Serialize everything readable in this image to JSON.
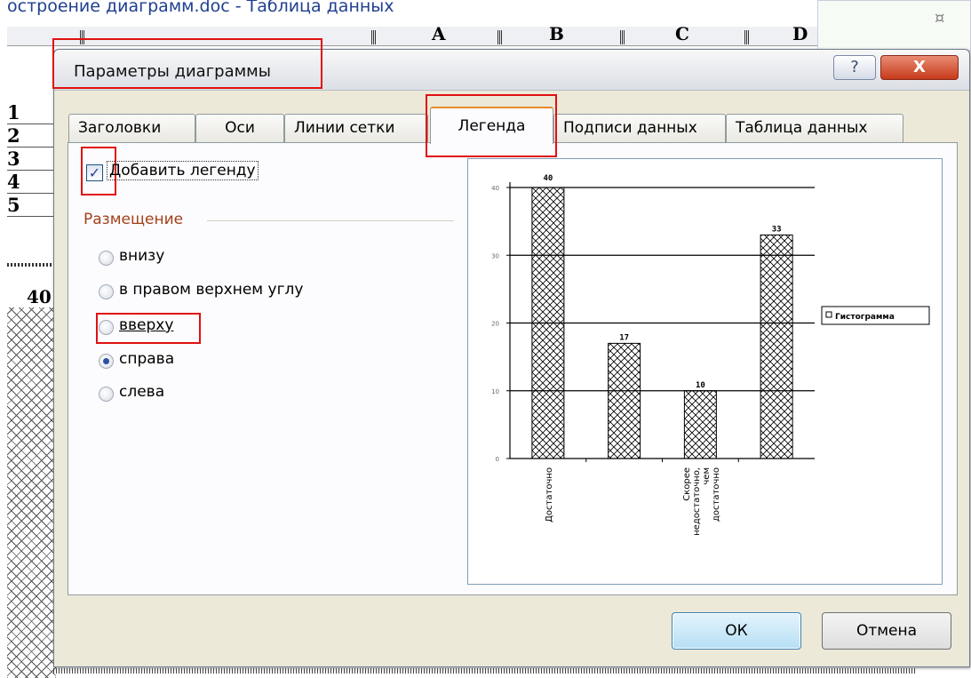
{
  "background": {
    "window_title": "остроение диаграмм.doc - Таблица данных",
    "columns": [
      "A",
      "B",
      "C",
      "D"
    ],
    "rows": [
      "1",
      "2",
      "3",
      "4",
      "5"
    ],
    "cell_value": "40",
    "corner_mark": "¤"
  },
  "dialog": {
    "title": "Параметры диаграммы",
    "help_label": "?",
    "close_label": "X",
    "tabs": [
      {
        "label": "Заголовки"
      },
      {
        "label": "Оси"
      },
      {
        "label": "Линии сетки"
      },
      {
        "label": "Легенда",
        "active": true
      },
      {
        "label": "Подписи данных"
      },
      {
        "label": "Таблица данных"
      }
    ],
    "add_legend_checkbox": {
      "label": "Добавить легенду",
      "checked": true
    },
    "placement_group": {
      "label": "Размещение",
      "options": [
        {
          "label": "внизу",
          "selected": false
        },
        {
          "label": "в правом верхнем углу",
          "selected": false
        },
        {
          "label": "вверху",
          "selected": false
        },
        {
          "label": "справа",
          "selected": true
        },
        {
          "label": "слева",
          "selected": false
        }
      ]
    },
    "buttons": {
      "ok": "ОК",
      "cancel": "Отмена"
    },
    "colors": {
      "highlight": "#e01010",
      "accent": "#e68b2c"
    }
  },
  "chart_data": {
    "type": "bar",
    "categories": [
      "Достаточно",
      "",
      "Скорее недостаточно, чем достаточно",
      ""
    ],
    "series": [
      {
        "name": "Гистограмма",
        "values": [
          40,
          17,
          10,
          33
        ]
      }
    ],
    "data_labels": [
      "40",
      "17",
      "10",
      "33"
    ],
    "yticks": [
      "0",
      "10",
      "20",
      "30",
      "40"
    ],
    "ylim": [
      0,
      40
    ],
    "grid": true,
    "legend_placement": "right",
    "bar_pattern": "cross-hatch"
  }
}
